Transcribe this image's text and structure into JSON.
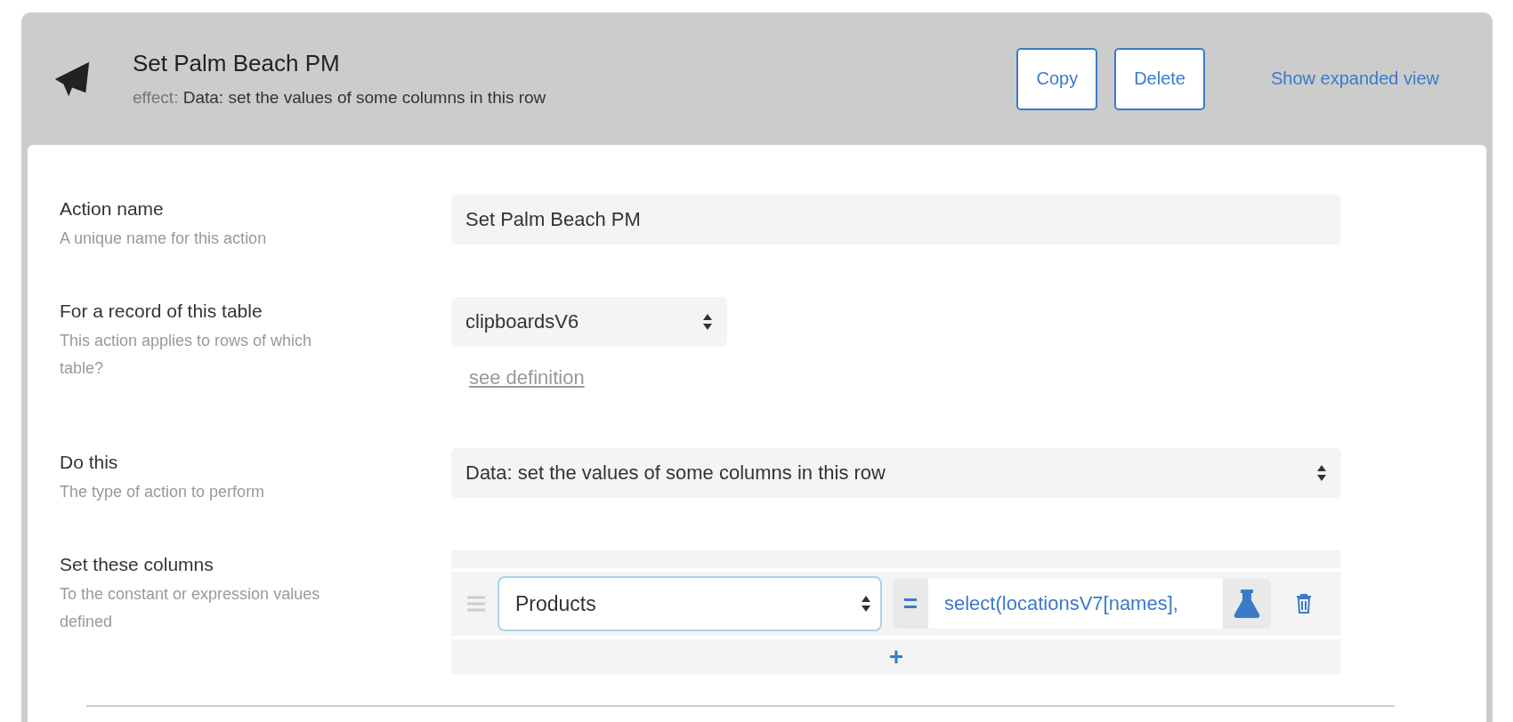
{
  "header": {
    "title": "Set Palm Beach PM",
    "effect_label": "effect:",
    "effect_text": "Data: set the values of some columns in this row",
    "buttons": [
      "Copy",
      "Delete"
    ],
    "link": "Show expanded view"
  },
  "fields": [
    {
      "kind": "text",
      "label": "Action name",
      "hint": "A unique name for this action",
      "value": "Set Palm Beach PM"
    },
    {
      "kind": "select",
      "label": "For a record of this table",
      "hint": "This action applies to rows of which table?",
      "value": "clipboardsV6",
      "link": "see definition"
    },
    {
      "kind": "select-wide",
      "label": "Do this",
      "hint": "The type of action to perform",
      "value": "Data: set the values of some columns in this row"
    },
    {
      "kind": "columns",
      "label": "Set these columns",
      "hint": "To the constant or expression values defined",
      "rows": [
        {
          "column": "Products",
          "operator": "=",
          "expression": "select(locationsV7[names],"
        }
      ],
      "add": "+"
    }
  ]
}
